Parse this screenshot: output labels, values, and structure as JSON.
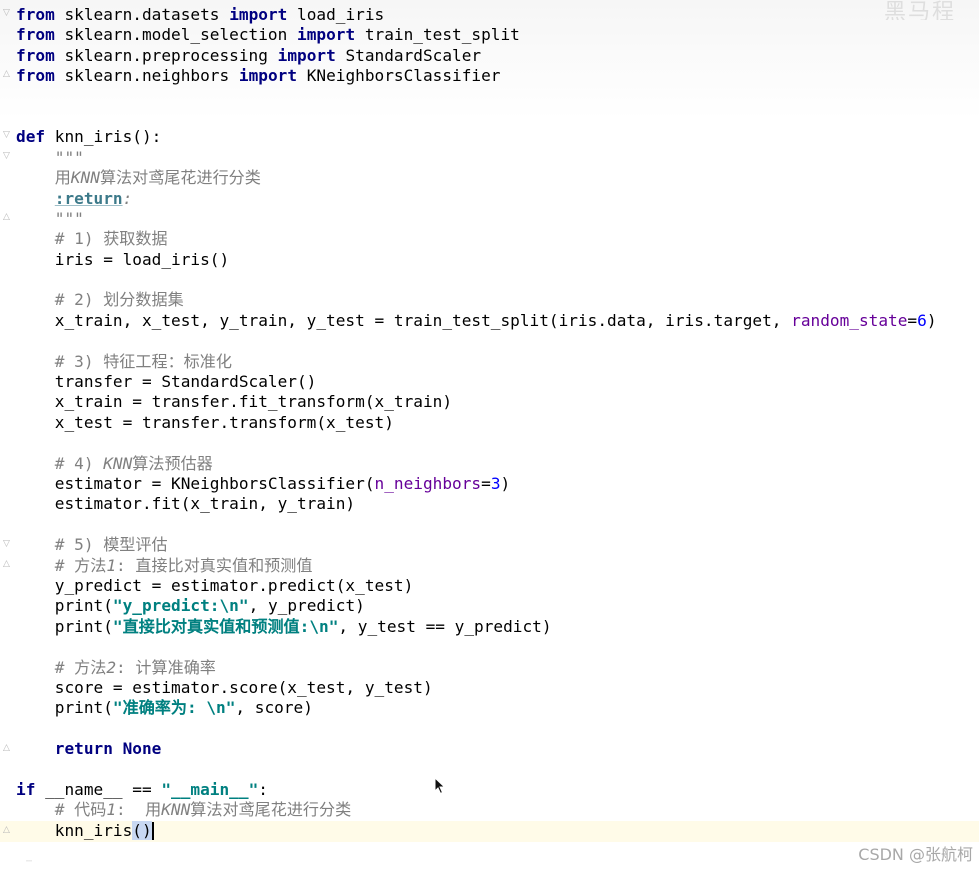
{
  "editor": {
    "lines": {
      "l01": {
        "a": "from",
        "b": " sklearn.datasets ",
        "c": "import",
        "d": " load_iris"
      },
      "l02": {
        "a": "from",
        "b": " sklearn.model_selection ",
        "c": "import",
        "d": " train_test_split"
      },
      "l03": {
        "a": "from",
        "b": " sklearn.preprocessing ",
        "c": "import",
        "d": " StandardScaler"
      },
      "l04": {
        "a": "from",
        "b": " sklearn.neighbors ",
        "c": "import",
        "d": " KNeighborsClassifier"
      },
      "l07": {
        "a": "def",
        "b": " knn_iris():"
      },
      "l08": {
        "a": "    \"\"\""
      },
      "l09": {
        "a": "    用",
        "b": "KNN",
        "c": "算法对鸢尾花进行分类"
      },
      "l10": {
        "a": "    ",
        "b": ":return",
        "c": ":"
      },
      "l11": {
        "a": "    \"\"\""
      },
      "l12": {
        "a": "    # 1) 获取数据"
      },
      "l13": {
        "a": "    iris = load_iris()"
      },
      "l15": {
        "a": "    # 2) 划分数据集"
      },
      "l16": {
        "a": "    x_train, x_test, y_train, y_test = train_test_split(iris.data, iris.target, ",
        "b": "random_state",
        "c": "=",
        "d": "6",
        "e": ")"
      },
      "l18": {
        "a": "    # 3) 特征工程：标准化"
      },
      "l19": {
        "a": "    transfer = StandardScaler()"
      },
      "l20": {
        "a": "    x_train = transfer.fit_transform(x_train)"
      },
      "l21": {
        "a": "    x_test = transfer.transform(x_test)"
      },
      "l23": {
        "a": "    # 4) ",
        "b": "KNN",
        "c": "算法预估器"
      },
      "l24": {
        "a": "    estimator = KNeighborsClassifier(",
        "b": "n_neighbors",
        "c": "=",
        "d": "3",
        "e": ")"
      },
      "l25": {
        "a": "    estimator.fit(x_train, y_train)"
      },
      "l27": {
        "a": "    # 5) 模型评估"
      },
      "l28": {
        "a": "    # 方法",
        "b": "1",
        "c": ": 直接比对真实值和预测值"
      },
      "l29": {
        "a": "    y_predict = estimator.predict(x_test)"
      },
      "l30": {
        "a": "    print(",
        "b": "\"y_predict:\\n\"",
        "c": ", y_predict)"
      },
      "l31": {
        "a": "    print(",
        "b": "\"直接比对真实值和预测值:\\n\"",
        "c": ", y_test == y_predict)"
      },
      "l33": {
        "a": "    # 方法",
        "b": "2",
        "c": ": 计算准确率"
      },
      "l34": {
        "a": "    score = estimator.score(x_test, y_test)"
      },
      "l35": {
        "a": "    print(",
        "b": "\"准确率为: \\n\"",
        "c": ", score)"
      },
      "l37": {
        "a": "    ",
        "b": "return",
        "c": " ",
        "d": "None"
      },
      "l39": {
        "a": "if",
        "b": " __name__ == ",
        "c": "\"__main__\"",
        "d": ":"
      },
      "l40": {
        "a": "    # 代码",
        "b": "1",
        "c": ":  用",
        "d": "KNN",
        "e": "算法对鸢尾花进行分类"
      },
      "l41": {
        "a": "    knn_iris",
        "b": "()"
      }
    }
  },
  "watermark": "CSDN @张航柯",
  "corner_logo": "黑马程序员",
  "icons": {
    "fold": "fold-marker-icon",
    "cursor": "mouse-pointer-icon"
  },
  "colors": {
    "keyword": "#000080",
    "comment": "#808080",
    "string": "#008080",
    "kwarg": "#660099",
    "number": "#0000ff",
    "caret_line": "#fffbe8"
  }
}
